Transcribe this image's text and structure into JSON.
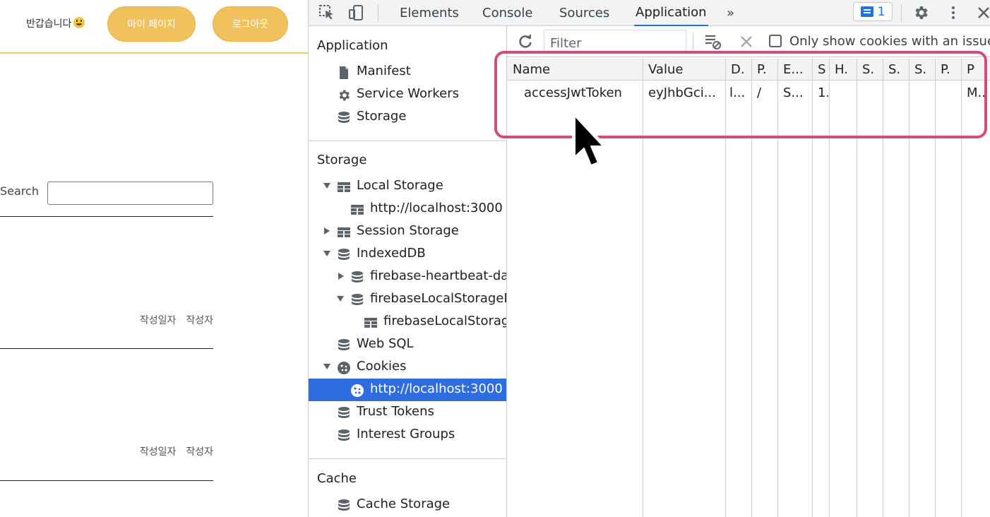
{
  "page": {
    "greeting": "반갑습니다",
    "mypage_button": "마이 페이지",
    "logout_button": "로그아웃",
    "search_label": "Search",
    "search_value": "",
    "posts": [
      {
        "date_label": "작성일자",
        "author_label": "작성자"
      },
      {
        "date_label": "작성일자",
        "author_label": "작성자"
      }
    ]
  },
  "devtools": {
    "tabs": [
      "Elements",
      "Console",
      "Sources",
      "Application"
    ],
    "active_tab": "Application",
    "more_tabs": "»",
    "issues_count": "1",
    "sidebar": {
      "application_title": "Application",
      "application_items": [
        "Manifest",
        "Service Workers",
        "Storage"
      ],
      "storage_title": "Storage",
      "storage_items": {
        "local_storage": "Local Storage",
        "local_storage_origin": "http://localhost:3000",
        "session_storage": "Session Storage",
        "indexeddb": "IndexedDB",
        "idb_heartbeat": "firebase-heartbeat-database",
        "idb_local": "firebaseLocalStorageDb",
        "idb_local_store": "firebaseLocalStorage",
        "web_sql": "Web SQL",
        "cookies": "Cookies",
        "cookies_origin": "http://localhost:3000",
        "trust_tokens": "Trust Tokens",
        "interest_groups": "Interest Groups"
      },
      "cache_title": "Cache",
      "cache_items": [
        "Cache Storage"
      ]
    },
    "cookies": {
      "filter_placeholder": "Filter",
      "only_issues_label": "Only show cookies with an issue",
      "columns": [
        "Name",
        "Value",
        "D.",
        "P.",
        "E...",
        "S",
        "H.",
        "S.",
        "S.",
        "S.",
        "P.",
        "P"
      ],
      "rows": [
        [
          "accessJwtToken",
          "eyJhbGci...",
          "l...",
          "/",
          "S...",
          "1.",
          "",
          "",
          "",
          "",
          "",
          "M.."
        ]
      ]
    }
  },
  "colors": {
    "accent_yellow": "#f1c15e",
    "devtools_blue": "#1a73e8",
    "selection": "#2e6de0",
    "annotation": "#d14b7e"
  }
}
